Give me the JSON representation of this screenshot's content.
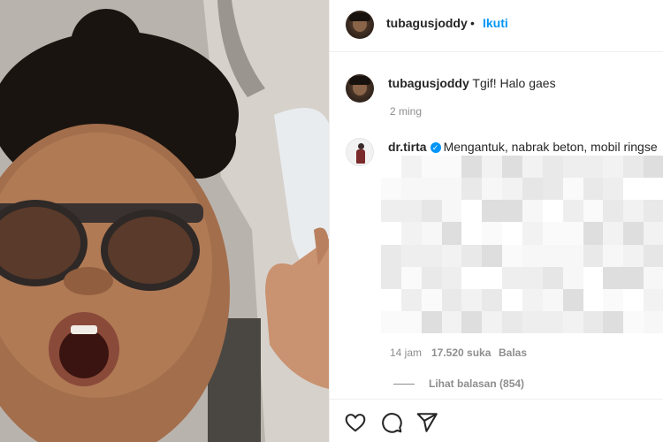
{
  "header": {
    "username": "tubagusjoddy",
    "separator": "•",
    "follow_label": "Ikuti"
  },
  "caption": {
    "username": "tubagusjoddy",
    "text": "Tgif! Halo gaes",
    "time": "2 ming"
  },
  "comment": {
    "username": "dr.tirta",
    "text": "Mengantuk, nabrak beton, mobil ringse",
    "time": "14 jam",
    "likes": "17.520 suka",
    "reply_label": "Balas",
    "view_replies": "Lihat balasan (854)"
  },
  "icons": {
    "like": "heart-icon",
    "comment": "comment-icon",
    "share": "share-icon",
    "verified": "verified-badge-icon"
  },
  "colors": {
    "accent": "#0095f6",
    "text": "#262626",
    "muted": "#8e8e8e"
  }
}
